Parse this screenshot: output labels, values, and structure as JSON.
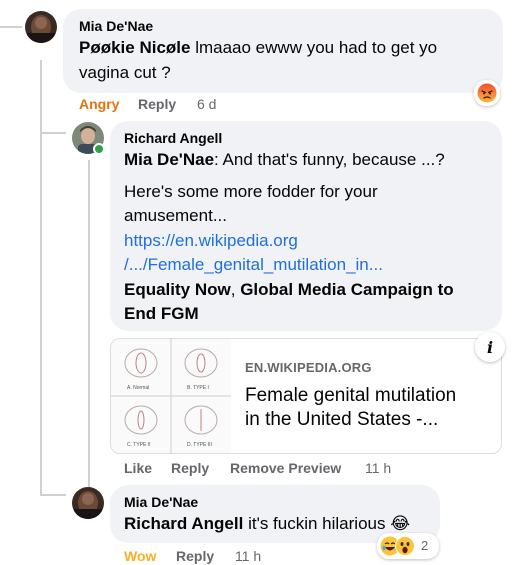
{
  "comments": [
    {
      "author": "Mia De'Nae",
      "mention": "Pøøkie Nicøle",
      "text_line1": " lmaaao ewww you had to get yo",
      "text_line2": "vagina cut ?",
      "actions": {
        "reaction": "Angry",
        "reply": "Reply",
        "time": "6 d"
      },
      "reaction_icon": "angry-emoji",
      "reaction_color": "#e9710f"
    },
    {
      "author": "Richard Angell",
      "mention": "Mia De'Nae",
      "text_line1": ": And that's funny, because ...?",
      "text_line2": "Here's some more fodder for your",
      "text_line3": "amusement...",
      "link_line1": "https://en.wikipedia.org",
      "link_line2": "/.../Female_genital_mutilation_in...",
      "bold_line1_a": "Equality Now",
      "bold_line1_sep": ", ",
      "bold_line1_b": "Global Media Campaign to",
      "bold_line2": "End FGM",
      "link_preview": {
        "domain": "EN.WIKIPEDIA.ORG",
        "title_line1": "Female genital mutilation",
        "title_line2": "in the United States -...",
        "thumb_labels": [
          "A. Normal",
          "B. TYPE I",
          "C. TYPE II",
          "D. TYPE III"
        ]
      },
      "actions": {
        "like": "Like",
        "reply": "Reply",
        "remove_preview": "Remove Preview",
        "time": "11 h"
      }
    },
    {
      "author": "Mia De'Nae",
      "mention": "Richard Angell",
      "text_line1": " it's fuckin hilarious ",
      "text_emoji": "😂",
      "actions": {
        "reaction": "Wow",
        "reply": "Reply",
        "time": "11 h"
      },
      "reaction_count": "2",
      "reaction_color": "#f7b125",
      "reaction_icons": [
        "laughing-emoji",
        "wow-emoji"
      ]
    }
  ]
}
